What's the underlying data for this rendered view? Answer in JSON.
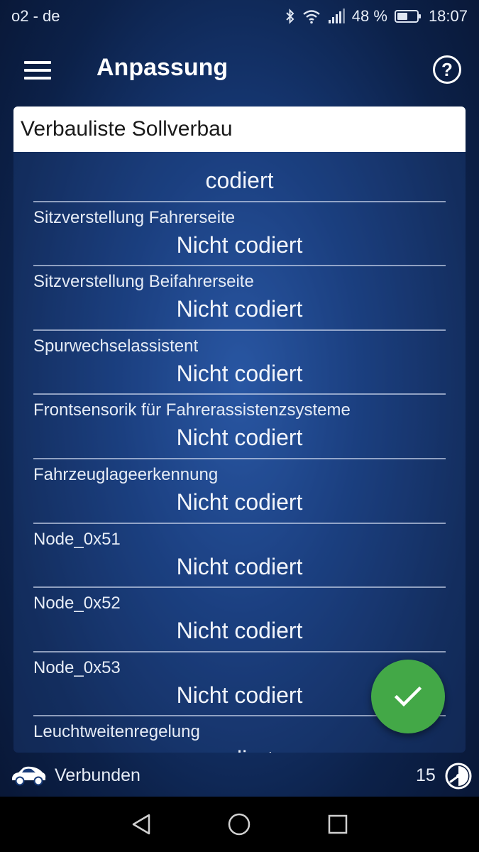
{
  "status_bar": {
    "carrier": "o2 - de",
    "battery_percent": "48 %",
    "time": "18:07",
    "icons": [
      "bluetooth-icon",
      "wifi-icon",
      "signal-icon",
      "battery-icon"
    ]
  },
  "app_bar": {
    "title": "Anpassung",
    "menu_icon": "hamburger-menu-icon",
    "help_icon": "help-icon",
    "help_glyph": "?"
  },
  "card": {
    "header": "Verbauliste Sollverbau",
    "items": [
      {
        "label": "",
        "value": "codiert"
      },
      {
        "label": "Sitzverstellung Fahrerseite",
        "value": "Nicht codiert"
      },
      {
        "label": "Sitzverstellung Beifahrerseite",
        "value": "Nicht codiert"
      },
      {
        "label": "Spurwechselassistent",
        "value": "Nicht codiert"
      },
      {
        "label": "Frontsensorik für Fahrerassistenzsysteme",
        "value": "Nicht codiert"
      },
      {
        "label": "Fahrzeuglageerkennung",
        "value": "Nicht codiert"
      },
      {
        "label": "Node_0x51",
        "value": "Nicht codiert"
      },
      {
        "label": "Node_0x52",
        "value": "Nicht codiert"
      },
      {
        "label": "Node_0x53",
        "value": "Nicht codiert"
      },
      {
        "label": "Leuchtweitenregelung",
        "value": "codiert"
      }
    ]
  },
  "fab": {
    "icon": "checkmark-icon",
    "color": "#43a847"
  },
  "footer": {
    "connection_status": "Verbunden",
    "count": "15",
    "car_icon": "car-icon",
    "gauge_icon": "gauge-icon"
  },
  "nav_bar": {
    "icons": [
      "back-icon",
      "home-icon",
      "recents-icon"
    ]
  }
}
